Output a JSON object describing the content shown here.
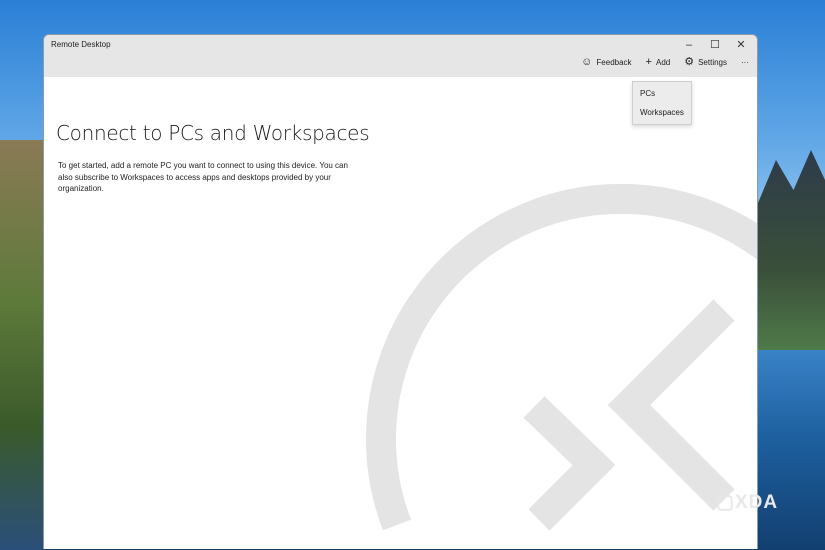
{
  "window": {
    "title": "Remote Desktop"
  },
  "controls": {
    "minimize": "–",
    "maximize": "☐",
    "close": "✕"
  },
  "toolbar": {
    "feedback": "Feedback",
    "add": "Add",
    "settings": "Settings",
    "more": "···"
  },
  "add_menu": {
    "items": [
      "PCs",
      "Workspaces"
    ]
  },
  "main": {
    "heading": "Connect to PCs and Workspaces",
    "description": "To get started, add a remote PC you want to connect to using this device. You can also subscribe to Workspaces to access apps and desktops provided by your organization."
  },
  "watermark": {
    "brand": "XDA"
  }
}
